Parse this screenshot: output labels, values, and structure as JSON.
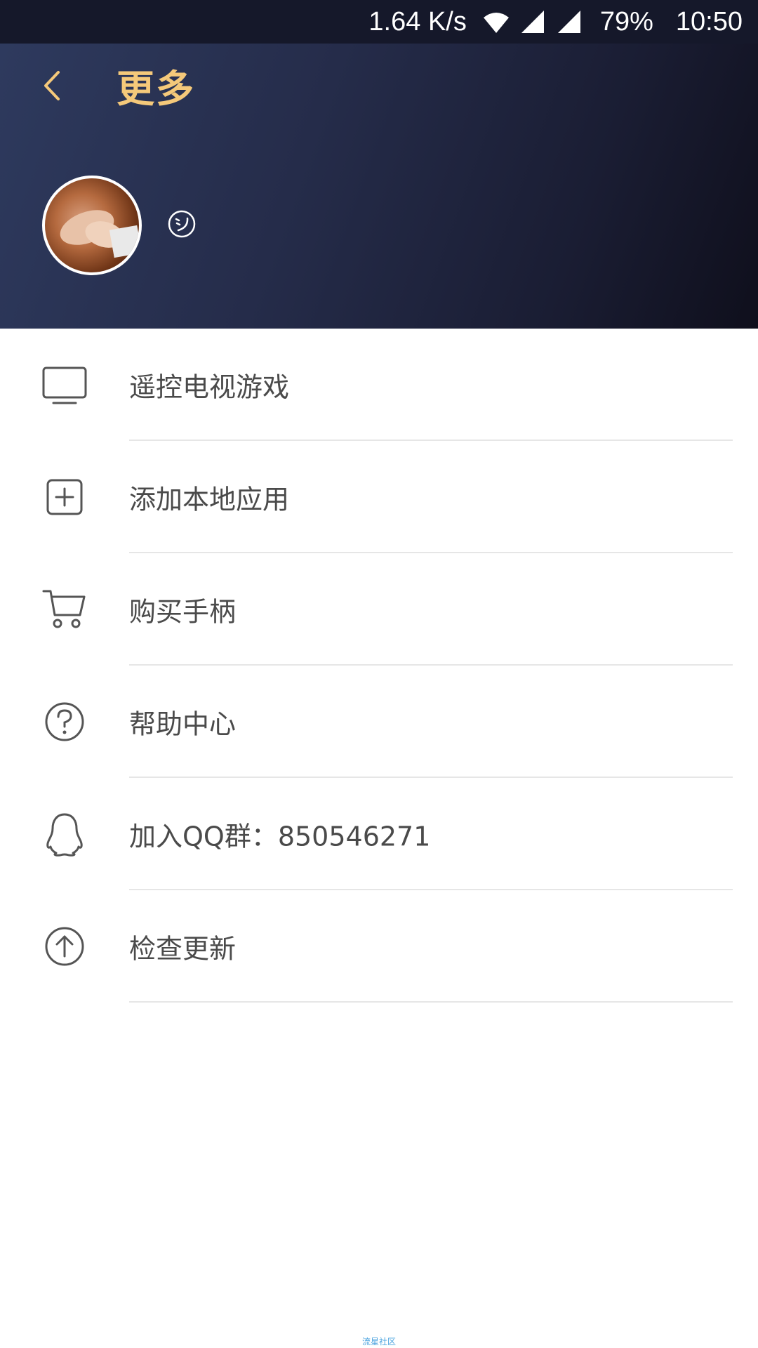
{
  "status_bar": {
    "speed": "1.64 K/s",
    "battery": "79%",
    "time": "10:50",
    "icons": [
      "wifi-icon",
      "signal-icon",
      "signal-icon"
    ]
  },
  "header": {
    "title": "更多",
    "title_color": "#f5c97a",
    "back_icon": "chevron-left-icon",
    "avatar": "user-avatar",
    "status_icon": "smile-icon"
  },
  "menu": {
    "items": [
      {
        "label": "遥控电视游戏",
        "icon": "tv-icon"
      },
      {
        "label": "添加本地应用",
        "icon": "add-square-icon"
      },
      {
        "label": "购买手柄",
        "icon": "cart-icon"
      },
      {
        "label": "帮助中心",
        "icon": "help-icon"
      },
      {
        "label": "加入QQ群：850546271",
        "icon": "qq-icon"
      },
      {
        "label": "检查更新",
        "icon": "upload-icon"
      }
    ]
  },
  "footer": {
    "watermark": "流星社区"
  }
}
